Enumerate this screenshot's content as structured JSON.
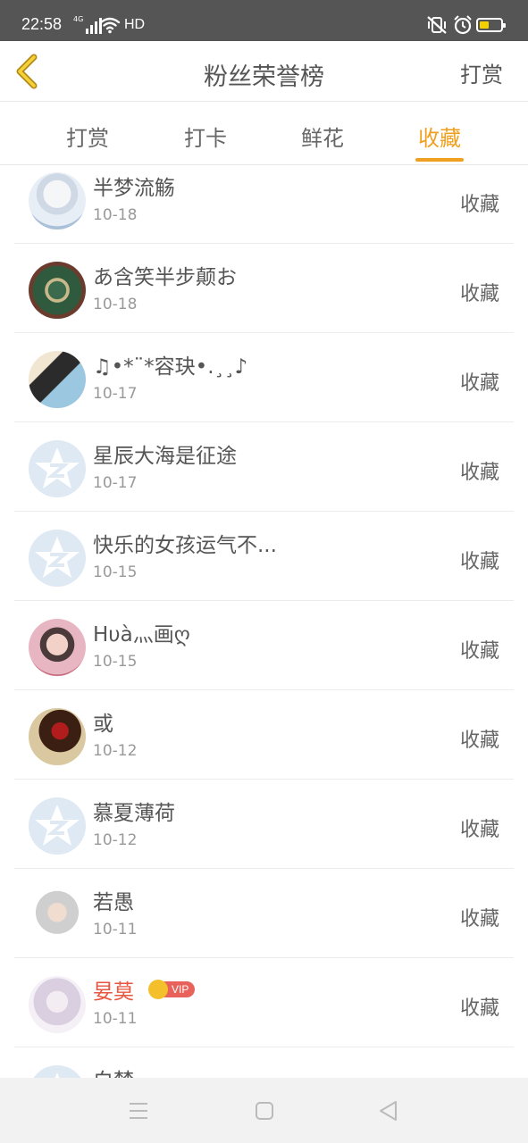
{
  "status_bar": {
    "time": "22:58",
    "network": "4G",
    "hd": "HD",
    "battery_level": 0.45,
    "battery_color": "#f5d000"
  },
  "header": {
    "back_icon": "chevron-left-icon",
    "title": "粉丝荣誉榜",
    "action": "打赏",
    "accent_color": "#f0a020"
  },
  "tabs": [
    {
      "label": "打赏",
      "active": false
    },
    {
      "label": "打卡",
      "active": false
    },
    {
      "label": "鲜花",
      "active": false
    },
    {
      "label": "收藏",
      "active": true
    }
  ],
  "list": {
    "items": [
      {
        "name": "半梦流觞",
        "date": "10-18",
        "action": "收藏"
      },
      {
        "name": "あ含笑半步颠お",
        "date": "10-18",
        "action": "收藏"
      },
      {
        "name": "♫•*¨*容玦•.¸¸♪",
        "date": "10-17",
        "action": "收藏"
      },
      {
        "name": "星辰大海是征途",
        "date": "10-17",
        "action": "收藏"
      },
      {
        "name": "快乐的女孩运气不...",
        "date": "10-15",
        "action": "收藏"
      },
      {
        "name": "Hυà灬画ღ",
        "date": "10-15",
        "action": "收藏"
      },
      {
        "name": "或",
        "date": "10-12",
        "action": "收藏"
      },
      {
        "name": "慕夏薄荷",
        "date": "10-12",
        "action": "收藏"
      },
      {
        "name": "若愚",
        "date": "10-11",
        "action": "收藏"
      },
      {
        "name": "妟莫",
        "date": "10-11",
        "action": "收藏",
        "vip_label": "VIP"
      },
      {
        "name": "白梦",
        "date": "",
        "action": ""
      }
    ]
  },
  "nav_bar": {
    "menu_icon": "menu-icon",
    "home_icon": "home-square-icon",
    "back_icon": "back-triangle-icon"
  }
}
